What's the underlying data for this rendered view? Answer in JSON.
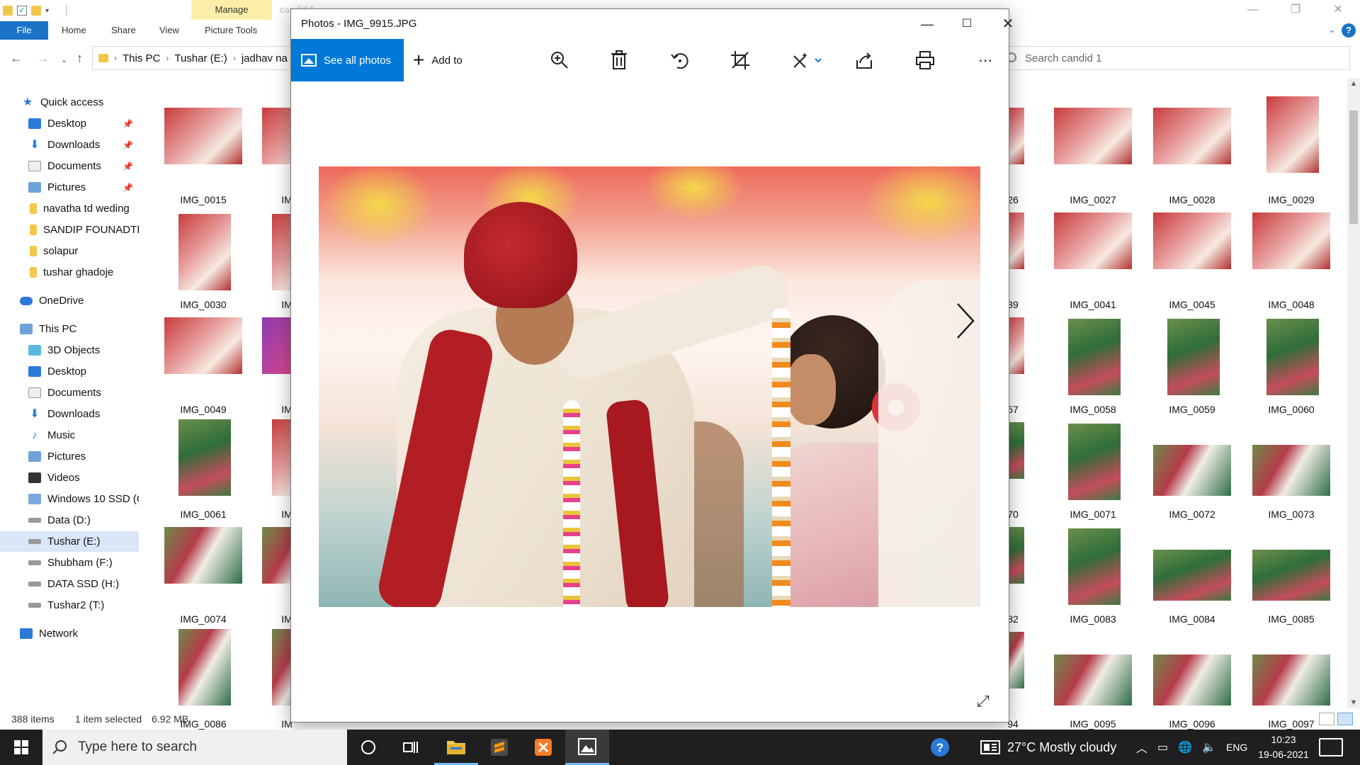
{
  "explorer": {
    "ribbon_context_tab": "Manage",
    "title_ghost": "candid 1",
    "tabs": [
      "File",
      "Home",
      "Share",
      "View",
      "Picture Tools"
    ],
    "address": [
      "This PC",
      "Tushar (E:)",
      "jadhav na"
    ],
    "search_placeholder": "Search candid 1",
    "sidebar": {
      "quick_access": "Quick access",
      "quick_items": [
        "Desktop",
        "Downloads",
        "Documents",
        "Pictures",
        "navatha td weding",
        "SANDIP FOUNADTIO",
        "solapur",
        "tushar ghadoje"
      ],
      "onedrive": "OneDrive",
      "this_pc": "This PC",
      "pc_items": [
        "3D Objects",
        "Desktop",
        "Documents",
        "Downloads",
        "Music",
        "Pictures",
        "Videos",
        "Windows 10 SSD (C",
        "Data (D:)",
        "Tushar (E:)",
        "Shubham (F:)",
        "DATA SSD (H:)",
        "Tushar2 (T:)"
      ],
      "network": "Network"
    },
    "left_thumbs": [
      "IMG_0015",
      "IMG_0030",
      "IMG_0049",
      "IMG_0061",
      "IMG_0074",
      "IMG_0086"
    ],
    "second_col_caps": [
      "IM",
      "IM",
      "IM",
      "IM",
      "IM",
      "IM"
    ],
    "partial_right_caps": [
      "26",
      "39",
      "57",
      "70",
      "82",
      "94"
    ],
    "right_thumbs": [
      [
        "IMG_0027",
        "IMG_0028",
        "IMG_0029"
      ],
      [
        "IMG_0041",
        "IMG_0045",
        "IMG_0048"
      ],
      [
        "IMG_0058",
        "IMG_0059",
        "IMG_0060"
      ],
      [
        "IMG_0071",
        "IMG_0072",
        "IMG_0073"
      ],
      [
        "IMG_0083",
        "IMG_0084",
        "IMG_0085"
      ],
      [
        "IMG_0095",
        "IMG_0096",
        "IMG_0097"
      ]
    ],
    "status": {
      "items": "388 items",
      "selected": "1 item selected",
      "size": "6.92 MB"
    }
  },
  "photos": {
    "title": "Photos - IMG_9915.JPG",
    "see_all": "See all photos",
    "add_to": "Add to"
  },
  "taskbar": {
    "search_placeholder": "Type here to search",
    "weather": "27°C  Mostly cloudy",
    "lang": "ENG",
    "time": "10:23",
    "date": "19-06-2021"
  },
  "colors": {
    "accent": "#0078d7",
    "file_tab": "#1a73c7",
    "manage_tab": "#fbeea8",
    "taskbar": "#1f1f1f"
  }
}
